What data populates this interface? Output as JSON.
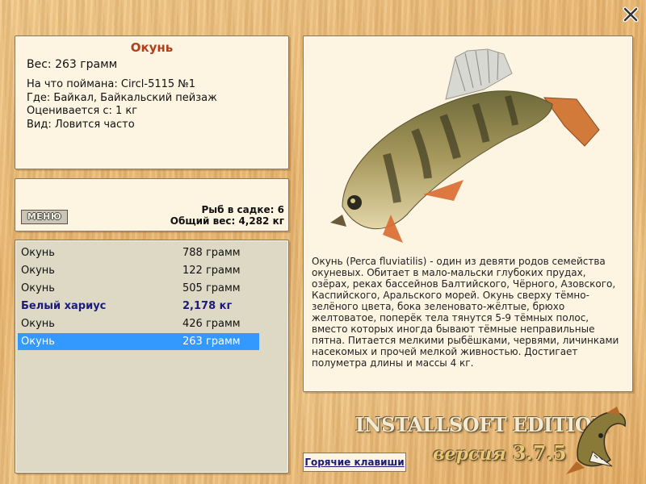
{
  "colors": {
    "accent_title": "#b0401a",
    "highlight": "#3399ff",
    "bold_fish": "#1c1a7a"
  },
  "icons": {
    "close": "close-x-icon"
  },
  "info": {
    "title": "Окунь",
    "weight": "Вес: 263 грамм",
    "bait": "На что поймана: Circl-5115 №1",
    "where": "Где: Байкал, Байкальский пейзаж",
    "value": "Оценивается с: 1 кг",
    "kind": "Вид: Ловится часто"
  },
  "stats": {
    "menu_label": "МЕНЮ",
    "count": "Рыб в садке: 6",
    "total": "Общий вес: 4,282 кг"
  },
  "catch_list": [
    {
      "name": "Окунь",
      "weight": "788 грамм"
    },
    {
      "name": "Окунь",
      "weight": "122 грамм"
    },
    {
      "name": "Окунь",
      "weight": "505 грамм"
    },
    {
      "name": "Белый хариус",
      "weight": "2,178 кг"
    },
    {
      "name": "Окунь",
      "weight": "426 грамм"
    },
    {
      "name": "Окунь",
      "weight": "263 грамм"
    }
  ],
  "description": "Окунь (Perca fluviatilis) - один из девяти родов семейства окуневых. Обитает в мало-мальски глубоких прудах, озёрах, реках бассейнов Балтийского, Чёрного, Азовского, Каспийского, Аральского морей. Окунь сверху тёмно-зелёного цвета, бока зеленовато-жёлтые, брюхо желтоватое, поперёк тела тянутся 5-9 тёмных полос, вместо которых иногда бывают тёмные неправильные пятна. Питается мелкими рыбёшками, червями, личинками насекомых и прочей мелкой живностью. Достигает полуметра длины и массы 4 кг.",
  "hotkeys_label": "Горячие клавиши",
  "brand": {
    "edition": "INSTALLSOFT EDITION",
    "version_word": "версия",
    "version_num": "3.7.5"
  }
}
